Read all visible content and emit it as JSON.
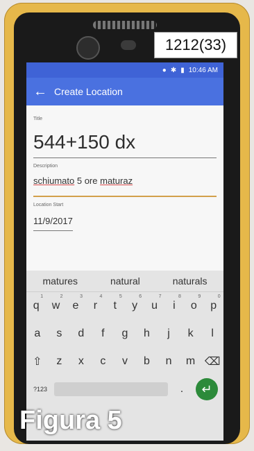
{
  "device": {
    "sticker": "1212(33)"
  },
  "status": {
    "time": "10:46 AM"
  },
  "appbar": {
    "title": "Create Location"
  },
  "form": {
    "title_label": "Title",
    "title_value": "544+150 dx",
    "description_label": "Description",
    "description_value_part1": "schiumato",
    "description_value_part2": " 5 ore ",
    "description_value_part3": "maturaz",
    "location_start_label": "Location Start",
    "location_start_value": "11/9/2017"
  },
  "keyboard": {
    "suggestions": [
      "matures",
      "natural",
      "naturals"
    ],
    "row1": [
      "q",
      "w",
      "e",
      "r",
      "t",
      "y",
      "u",
      "i",
      "o",
      "p"
    ],
    "row1_nums": [
      "1",
      "2",
      "3",
      "4",
      "5",
      "6",
      "7",
      "8",
      "9",
      "0"
    ],
    "row2": [
      "a",
      "s",
      "d",
      "f",
      "g",
      "h",
      "j",
      "k",
      "l"
    ],
    "row3": [
      "z",
      "x",
      "c",
      "v",
      "b",
      "n",
      "m"
    ],
    "sym_label": "?123",
    "period": "."
  },
  "caption": {
    "text": "Figura 5"
  }
}
